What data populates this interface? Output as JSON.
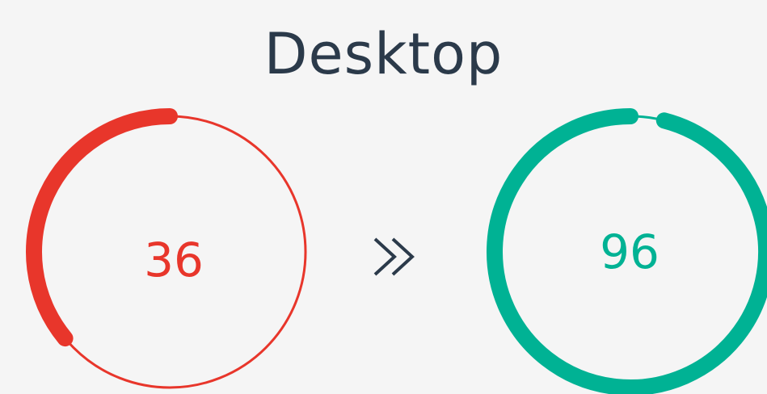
{
  "title": "Desktop",
  "before": {
    "score": "36",
    "value": 36,
    "color": "#e8362b"
  },
  "after": {
    "score": "96",
    "value": 96,
    "color": "#00b294"
  },
  "arrow_icon": "double-chevron-right-icon",
  "colors": {
    "text": "#2b3a4a",
    "background": "#f5f5f5"
  }
}
